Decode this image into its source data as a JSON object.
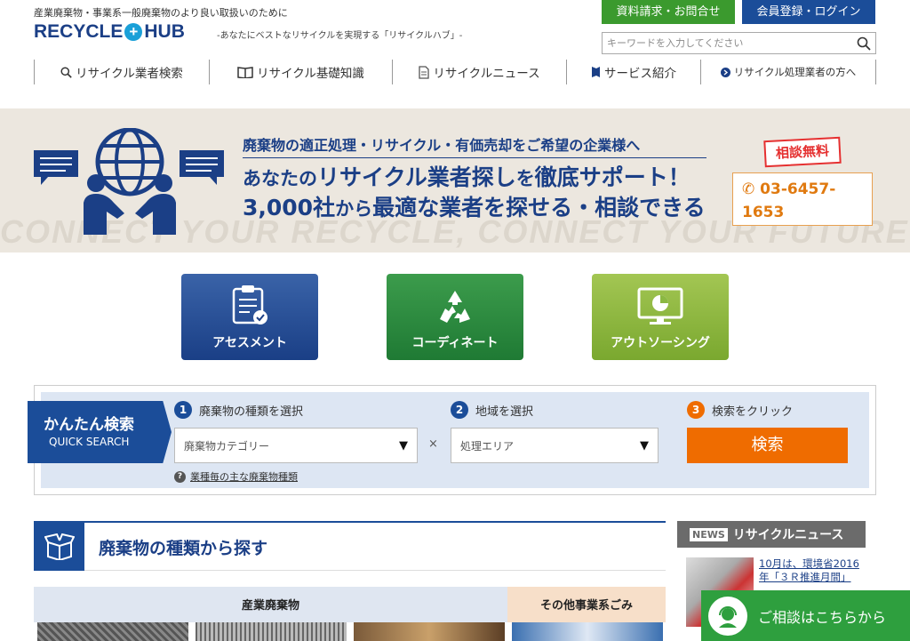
{
  "header": {
    "tagline": "産業廃棄物・事業系一般廃棄物のより良い取扱いのために",
    "logo_left": "RECYCLE",
    "logo_right": "HUB",
    "slogan": "-あなたにベストなリサイクルを実現する「リサイクルハブ」-",
    "doc_request": "資料請求・お問合せ",
    "member_login": "会員登録・ログイン",
    "search_placeholder": "キーワードを入力してください"
  },
  "nav": {
    "items": [
      {
        "label": "リサイクル業者検索",
        "icon": "search-icon"
      },
      {
        "label": "リサイクル基礎知識",
        "icon": "book-icon"
      },
      {
        "label": "リサイクルニュース",
        "icon": "document-icon"
      },
      {
        "label": "サービス紹介",
        "icon": "bookmark-icon"
      },
      {
        "label": "リサイクル処理業者の方へ",
        "icon": "arrow-circle-icon"
      }
    ]
  },
  "hero": {
    "line1": "廃棄物の適正処理・リサイクル・有価売却をご希望の企業様へ",
    "line2_a": "あなたの",
    "line2_b": "リサイクル業者探し",
    "line2_c": "を",
    "line2_d": "徹底サポート！",
    "line3_a": "3,000社",
    "line3_b": "から",
    "line3_c": "最適な業者を探せる・相談できる",
    "bg_text": "CONNECT YOUR RECYCLE, CONNECT YOUR FUTURE",
    "free_badge": "相談無料",
    "phone": "03-6457-1653"
  },
  "services": {
    "assessment": "アセスメント",
    "coordinate": "コーディネート",
    "outsourcing": "アウトソーシング"
  },
  "quick_search": {
    "title": "かんたん検索",
    "subtitle": "QUICK SEARCH",
    "step1_num": "1",
    "step1": "廃棄物の種類を選択",
    "step2_num": "2",
    "step2": "地域を選択",
    "step3_num": "3",
    "step3": "検索をクリック",
    "category_select": "廃棄物カテゴリー",
    "area_select": "処理エリア",
    "times": "×",
    "search_button": "検索",
    "help_link": "業種毎の主な廃棄物種類",
    "colors": {
      "step": "#1b4d99",
      "step3": "#ef6c00"
    }
  },
  "waste_section": {
    "title": "廃棄物の種類から探す",
    "industrial": "産業廃棄物",
    "other": "その他事業系ごみ"
  },
  "news": {
    "tag": "NEWS",
    "title": "リサイクルニュース",
    "item_text": "10月は、環境省2016年「３Ｒ推進月間」"
  },
  "consult": {
    "label": "ご相談はこちらから"
  }
}
